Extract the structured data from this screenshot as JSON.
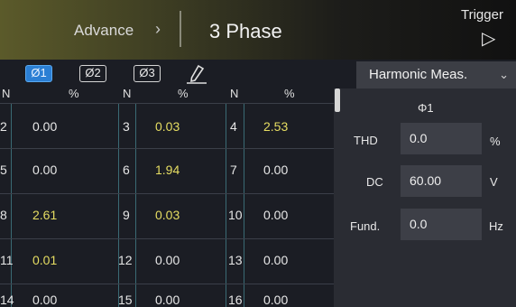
{
  "header": {
    "breadcrumb": "Advance",
    "chevron": "›",
    "title": "3 Phase",
    "trigger_label": "Trigger",
    "trigger_icon": "▷"
  },
  "toolbar": {
    "phases": [
      "Ø1",
      "Ø2",
      "Ø3"
    ],
    "active_phase": "Ø1",
    "edit_icon": "pen-icon",
    "mode_select": "Harmonic Meas.",
    "mode_caret": "⌄"
  },
  "table": {
    "headers": [
      "N",
      "%",
      "N",
      "%",
      "N",
      "%"
    ],
    "rows": [
      [
        {
          "n": "2",
          "v": "0.00",
          "hl": false
        },
        {
          "n": "3",
          "v": "0.03",
          "hl": true
        },
        {
          "n": "4",
          "v": "2.53",
          "hl": true
        }
      ],
      [
        {
          "n": "5",
          "v": "0.00",
          "hl": false
        },
        {
          "n": "6",
          "v": "1.94",
          "hl": true
        },
        {
          "n": "7",
          "v": "0.00",
          "hl": false
        }
      ],
      [
        {
          "n": "8",
          "v": "2.61",
          "hl": true
        },
        {
          "n": "9",
          "v": "0.03",
          "hl": true
        },
        {
          "n": "10",
          "v": "0.00",
          "hl": false
        }
      ],
      [
        {
          "n": "11",
          "v": "0.01",
          "hl": true
        },
        {
          "n": "12",
          "v": "0.00",
          "hl": false
        },
        {
          "n": "13",
          "v": "0.00",
          "hl": false
        }
      ],
      [
        {
          "n": "14",
          "v": "0.00",
          "hl": false
        },
        {
          "n": "15",
          "v": "0.00",
          "hl": false
        },
        {
          "n": "16",
          "v": "0.00",
          "hl": false
        }
      ]
    ]
  },
  "panel": {
    "phase_label": "Φ1",
    "thd": {
      "label": "THD",
      "value": "0.0",
      "unit": "%"
    },
    "dc": {
      "label": "DC",
      "value": "60.00",
      "unit": "V"
    },
    "fund": {
      "label": "Fund.",
      "value": "0.0",
      "unit": "Hz"
    }
  },
  "colors": {
    "highlight_value": "#e6dd62",
    "active_phase_button": "#2b7fd4",
    "background": "#1b1d24"
  }
}
